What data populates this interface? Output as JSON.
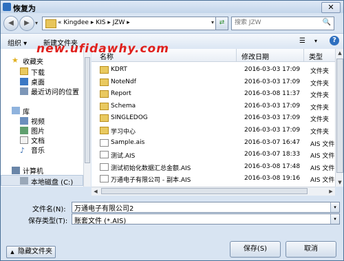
{
  "window": {
    "title": "恢复为",
    "close": "✕"
  },
  "nav": {
    "back": "◀",
    "forward": "▶",
    "menu": "▾"
  },
  "address": {
    "path": "« Kingdee ▸ KIS ▸ JZW ▸",
    "dropdown": "▾"
  },
  "refresh": "⇄",
  "search": {
    "placeholder": "搜索 JZW",
    "icon": "🔍"
  },
  "toolbar": {
    "organize": "组织 ▾",
    "new_folder": "新建文件夹",
    "views": "☰",
    "views_drop": "▾",
    "help": "?"
  },
  "watermark": "new.ufidawhy.com",
  "sidebar": {
    "favorites": "收藏夹",
    "items_fav": [
      "下载",
      "桌面",
      "最近访问的位置"
    ],
    "library": "库",
    "items_lib": [
      "视频",
      "图片",
      "文档",
      "音乐"
    ],
    "computer": "计算机",
    "local_disk": "本地磁盘 (C:)"
  },
  "columns": {
    "name": "名称",
    "modified": "修改日期",
    "type": "类型"
  },
  "files": [
    {
      "name": "KDRT",
      "date": "2016-03-03 17:09",
      "type": "文件夹",
      "kind": "folder"
    },
    {
      "name": "NoteNdf",
      "date": "2016-03-03 17:09",
      "type": "文件夹",
      "kind": "folder"
    },
    {
      "name": "Report",
      "date": "2016-03-08 11:37",
      "type": "文件夹",
      "kind": "folder"
    },
    {
      "name": "Schema",
      "date": "2016-03-03 17:09",
      "type": "文件夹",
      "kind": "folder"
    },
    {
      "name": "SINGLEDOG",
      "date": "2016-03-03 17:09",
      "type": "文件夹",
      "kind": "folder"
    },
    {
      "name": "学习中心",
      "date": "2016-03-03 17:09",
      "type": "文件夹",
      "kind": "folder"
    },
    {
      "name": "Sample.ais",
      "date": "2016-03-07 16:47",
      "type": "AIS 文件",
      "kind": "file"
    },
    {
      "name": "测试.AIS",
      "date": "2016-03-07 18:33",
      "type": "AIS 文件",
      "kind": "file"
    },
    {
      "name": "测试初始化数据汇总金额.AIS",
      "date": "2016-03-08 17:48",
      "type": "AIS 文件",
      "kind": "file"
    },
    {
      "name": "万通电子有限公司 - 副本.AIS",
      "date": "2016-03-08 19:16",
      "type": "AIS 文件",
      "kind": "file"
    }
  ],
  "form": {
    "filename_label": "文件名(N):",
    "filename_value": "万通电子有限公司2",
    "filetype_label": "保存类型(T):",
    "filetype_value": "账套文件 (*.AIS)",
    "drop": "▾"
  },
  "buttons": {
    "hide_folders": "隐藏文件夹",
    "hide_arrow": "▲",
    "save": "保存(S)",
    "cancel": "取消"
  },
  "scroll": {
    "up": "▲",
    "down": "▼",
    "left": "◀",
    "right": "▶"
  }
}
